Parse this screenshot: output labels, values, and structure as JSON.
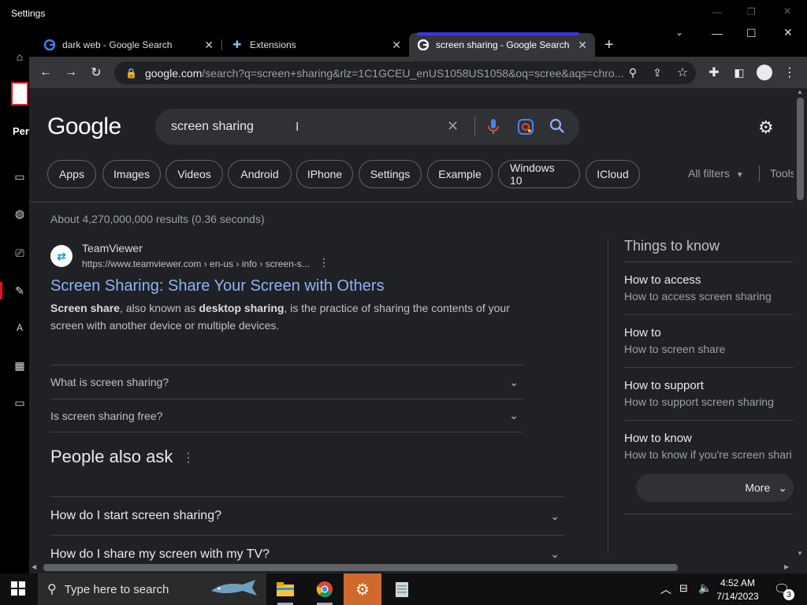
{
  "settings": {
    "title": "Settings",
    "partial_label": "Per"
  },
  "tabs": [
    {
      "title": "dark web - Google Search"
    },
    {
      "title": "Extensions"
    },
    {
      "title": "screen sharing - Google Search"
    }
  ],
  "omnibox": {
    "host": "google.com",
    "path": "/search?q=screen+sharing&rlz=1C1GCEU_enUS1058US1058&oq=scree&aqs=chro..."
  },
  "google": {
    "logo": "Google",
    "query": "screen sharing"
  },
  "chips": [
    "Apps",
    "Images",
    "Videos",
    "Android",
    "IPhone",
    "Settings",
    "Example",
    "Windows 10",
    "ICloud"
  ],
  "filters": {
    "all_filters": "All filters",
    "tools": "Tools"
  },
  "results_count": "About 4,270,000,000 results (0.36 seconds)",
  "result1": {
    "site": "TeamViewer",
    "url": "https://www.teamviewer.com › en-us › info › screen-s...",
    "title": "Screen Sharing: Share Your Screen with Others",
    "snippet_b1": "Screen share",
    "snippet_t1": ", also known as ",
    "snippet_b2": "desktop sharing",
    "snippet_t2": ", is the practice of sharing the contents of your screen with another device or multiple devices.",
    "faqs": [
      "What is screen sharing?",
      "Is screen sharing free?"
    ]
  },
  "people_also_ask": {
    "title": "People also ask",
    "questions": [
      "How do I start screen sharing?",
      "How do I share my screen with my TV?"
    ]
  },
  "things_to_know": {
    "title": "Things to know",
    "items": [
      {
        "heading": "How to access",
        "sub": "How to access screen sharing"
      },
      {
        "heading": "How to",
        "sub": "How to screen share"
      },
      {
        "heading": "How to support",
        "sub": "How to support screen sharing"
      },
      {
        "heading": "How to know",
        "sub": "How to know if you're screen shari"
      }
    ],
    "more": "More"
  },
  "taskbar": {
    "search_placeholder": "Type here to search",
    "time": "4:52 AM",
    "date": "7/14/2023",
    "notifications": "3"
  },
  "colors": {
    "link": "#8ab4f8",
    "page_bg": "#202124",
    "active_tab_accent": "#3b36e6"
  }
}
